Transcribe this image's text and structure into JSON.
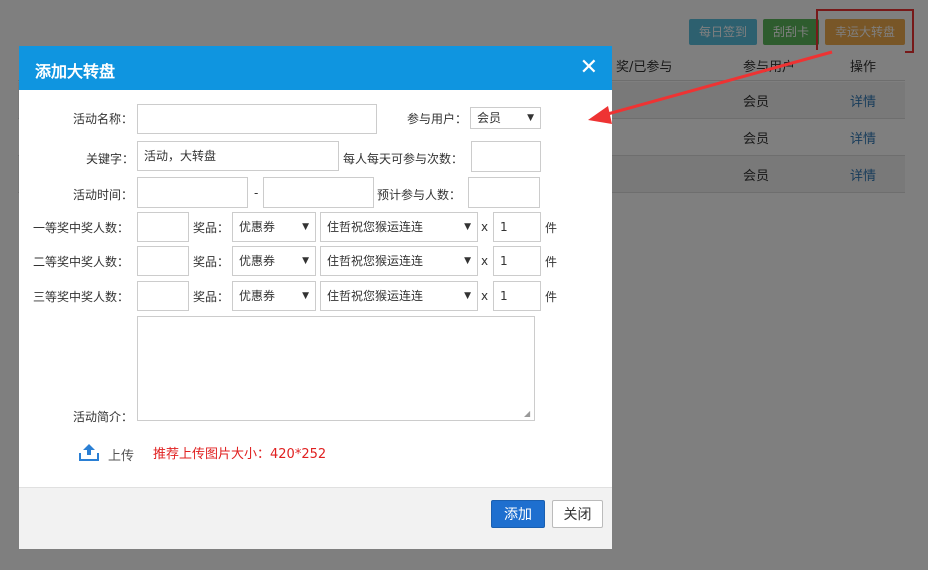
{
  "background": {
    "toolbar": [
      "每日签到",
      "刮刮卡",
      "幸运大转盘"
    ],
    "table": {
      "headers": [
        "奖/已参与",
        "参与用户",
        "操作"
      ],
      "rows": [
        {
          "user": "会员",
          "op": "详情"
        },
        {
          "user": "会员",
          "op": "详情"
        },
        {
          "user": "会员",
          "op": "详情"
        }
      ]
    }
  },
  "modal": {
    "title": "添加大转盘",
    "close_symbol": "✕",
    "form": {
      "activity_name_label": "活动名称：",
      "activity_name_value": "",
      "users_label": "参与用户：",
      "users_value": "会员",
      "keyword_label": "关键字：",
      "keyword_value": "活动，大转盘",
      "daily_times_label": "每人每天可参与次数：",
      "daily_times_value": "",
      "time_label": "活动时间：",
      "time_start": "",
      "time_separator": "-",
      "time_end": "",
      "expected_label": "预计参与人数：",
      "expected_value": "",
      "prize_tiers": [
        {
          "label": "一等奖中奖人数：",
          "count": "",
          "prize_label": "奖品：",
          "type": "优惠券",
          "item": "住哲祝您猴运连连",
          "times": "x",
          "qty": "1",
          "unit": "件"
        },
        {
          "label": "二等奖中奖人数：",
          "count": "",
          "prize_label": "奖品：",
          "type": "优惠券",
          "item": "住哲祝您猴运连连",
          "times": "x",
          "qty": "1",
          "unit": "件"
        },
        {
          "label": "三等奖中奖人数：",
          "count": "",
          "prize_label": "奖品：",
          "type": "优惠券",
          "item": "住哲祝您猴运连连",
          "times": "x",
          "qty": "1",
          "unit": "件"
        }
      ],
      "intro_label": "活动简介：",
      "intro_value": ""
    },
    "upload": {
      "label": "上传",
      "hint": "推荐上传图片大小：420*252",
      "icon": "upload-icon"
    },
    "footer": {
      "add": "添加",
      "close": "关闭"
    }
  },
  "colors": {
    "header": "#0f95e0",
    "primary": "#1e6fcf",
    "hint": "#e02020",
    "annotation": "#e33333"
  }
}
